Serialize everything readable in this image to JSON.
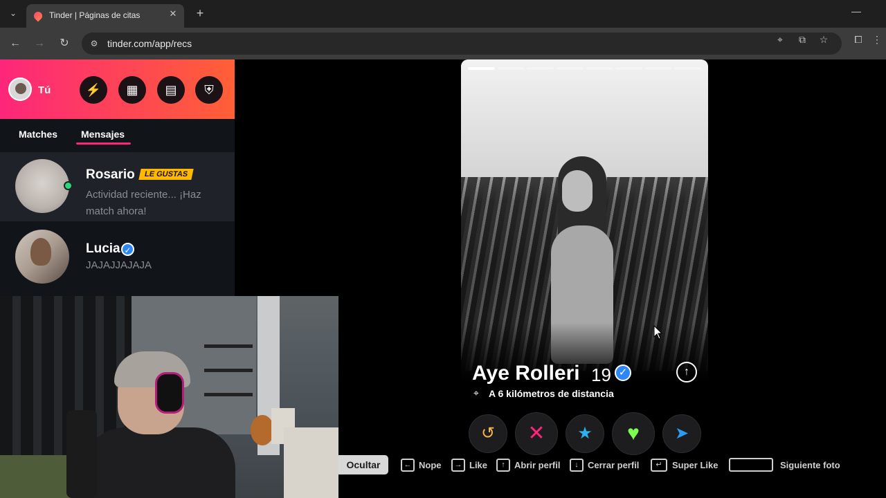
{
  "browser": {
    "tab_title": "Tinder | Páginas de citas",
    "tab_close": "✕",
    "new_tab": "+",
    "url": "tinder.com/app/recs",
    "minimize": "—"
  },
  "sidebar": {
    "me_label": "Tú",
    "tabs": [
      "Matches",
      "Mensajes"
    ],
    "messages": [
      {
        "name": "Rosario",
        "badge": "LE GUSTAS",
        "text": "Actividad reciente... ¡Haz match ahora!",
        "online": true
      },
      {
        "name": "Lucia",
        "text": "JAJAJJAJAJA",
        "verified": true
      }
    ]
  },
  "card": {
    "name": "Aye Rolleri",
    "age": "19",
    "distance": "A 6 kilómetros de distancia",
    "photo_count": 8,
    "photo_index": 1
  },
  "actions": {
    "rewind": "↺",
    "nope": "✕",
    "superlike": "★",
    "like": "♥",
    "boost": "➤"
  },
  "hints": {
    "hide": "Ocultar",
    "nope": "Nope",
    "like": "Like",
    "open_profile": "Abrir perfil",
    "close_profile": "Cerrar perfil",
    "super_like": "Super Like",
    "next_photo": "Siguiente foto"
  },
  "colors": {
    "brand_gradient_start": "#fd267a",
    "brand_gradient_end": "#ff6036",
    "rewind": "#f5b748",
    "nope": "#fd267a",
    "superlike": "#2db0f0",
    "like": "#7dfc51",
    "boost": "#2b9cf2"
  }
}
